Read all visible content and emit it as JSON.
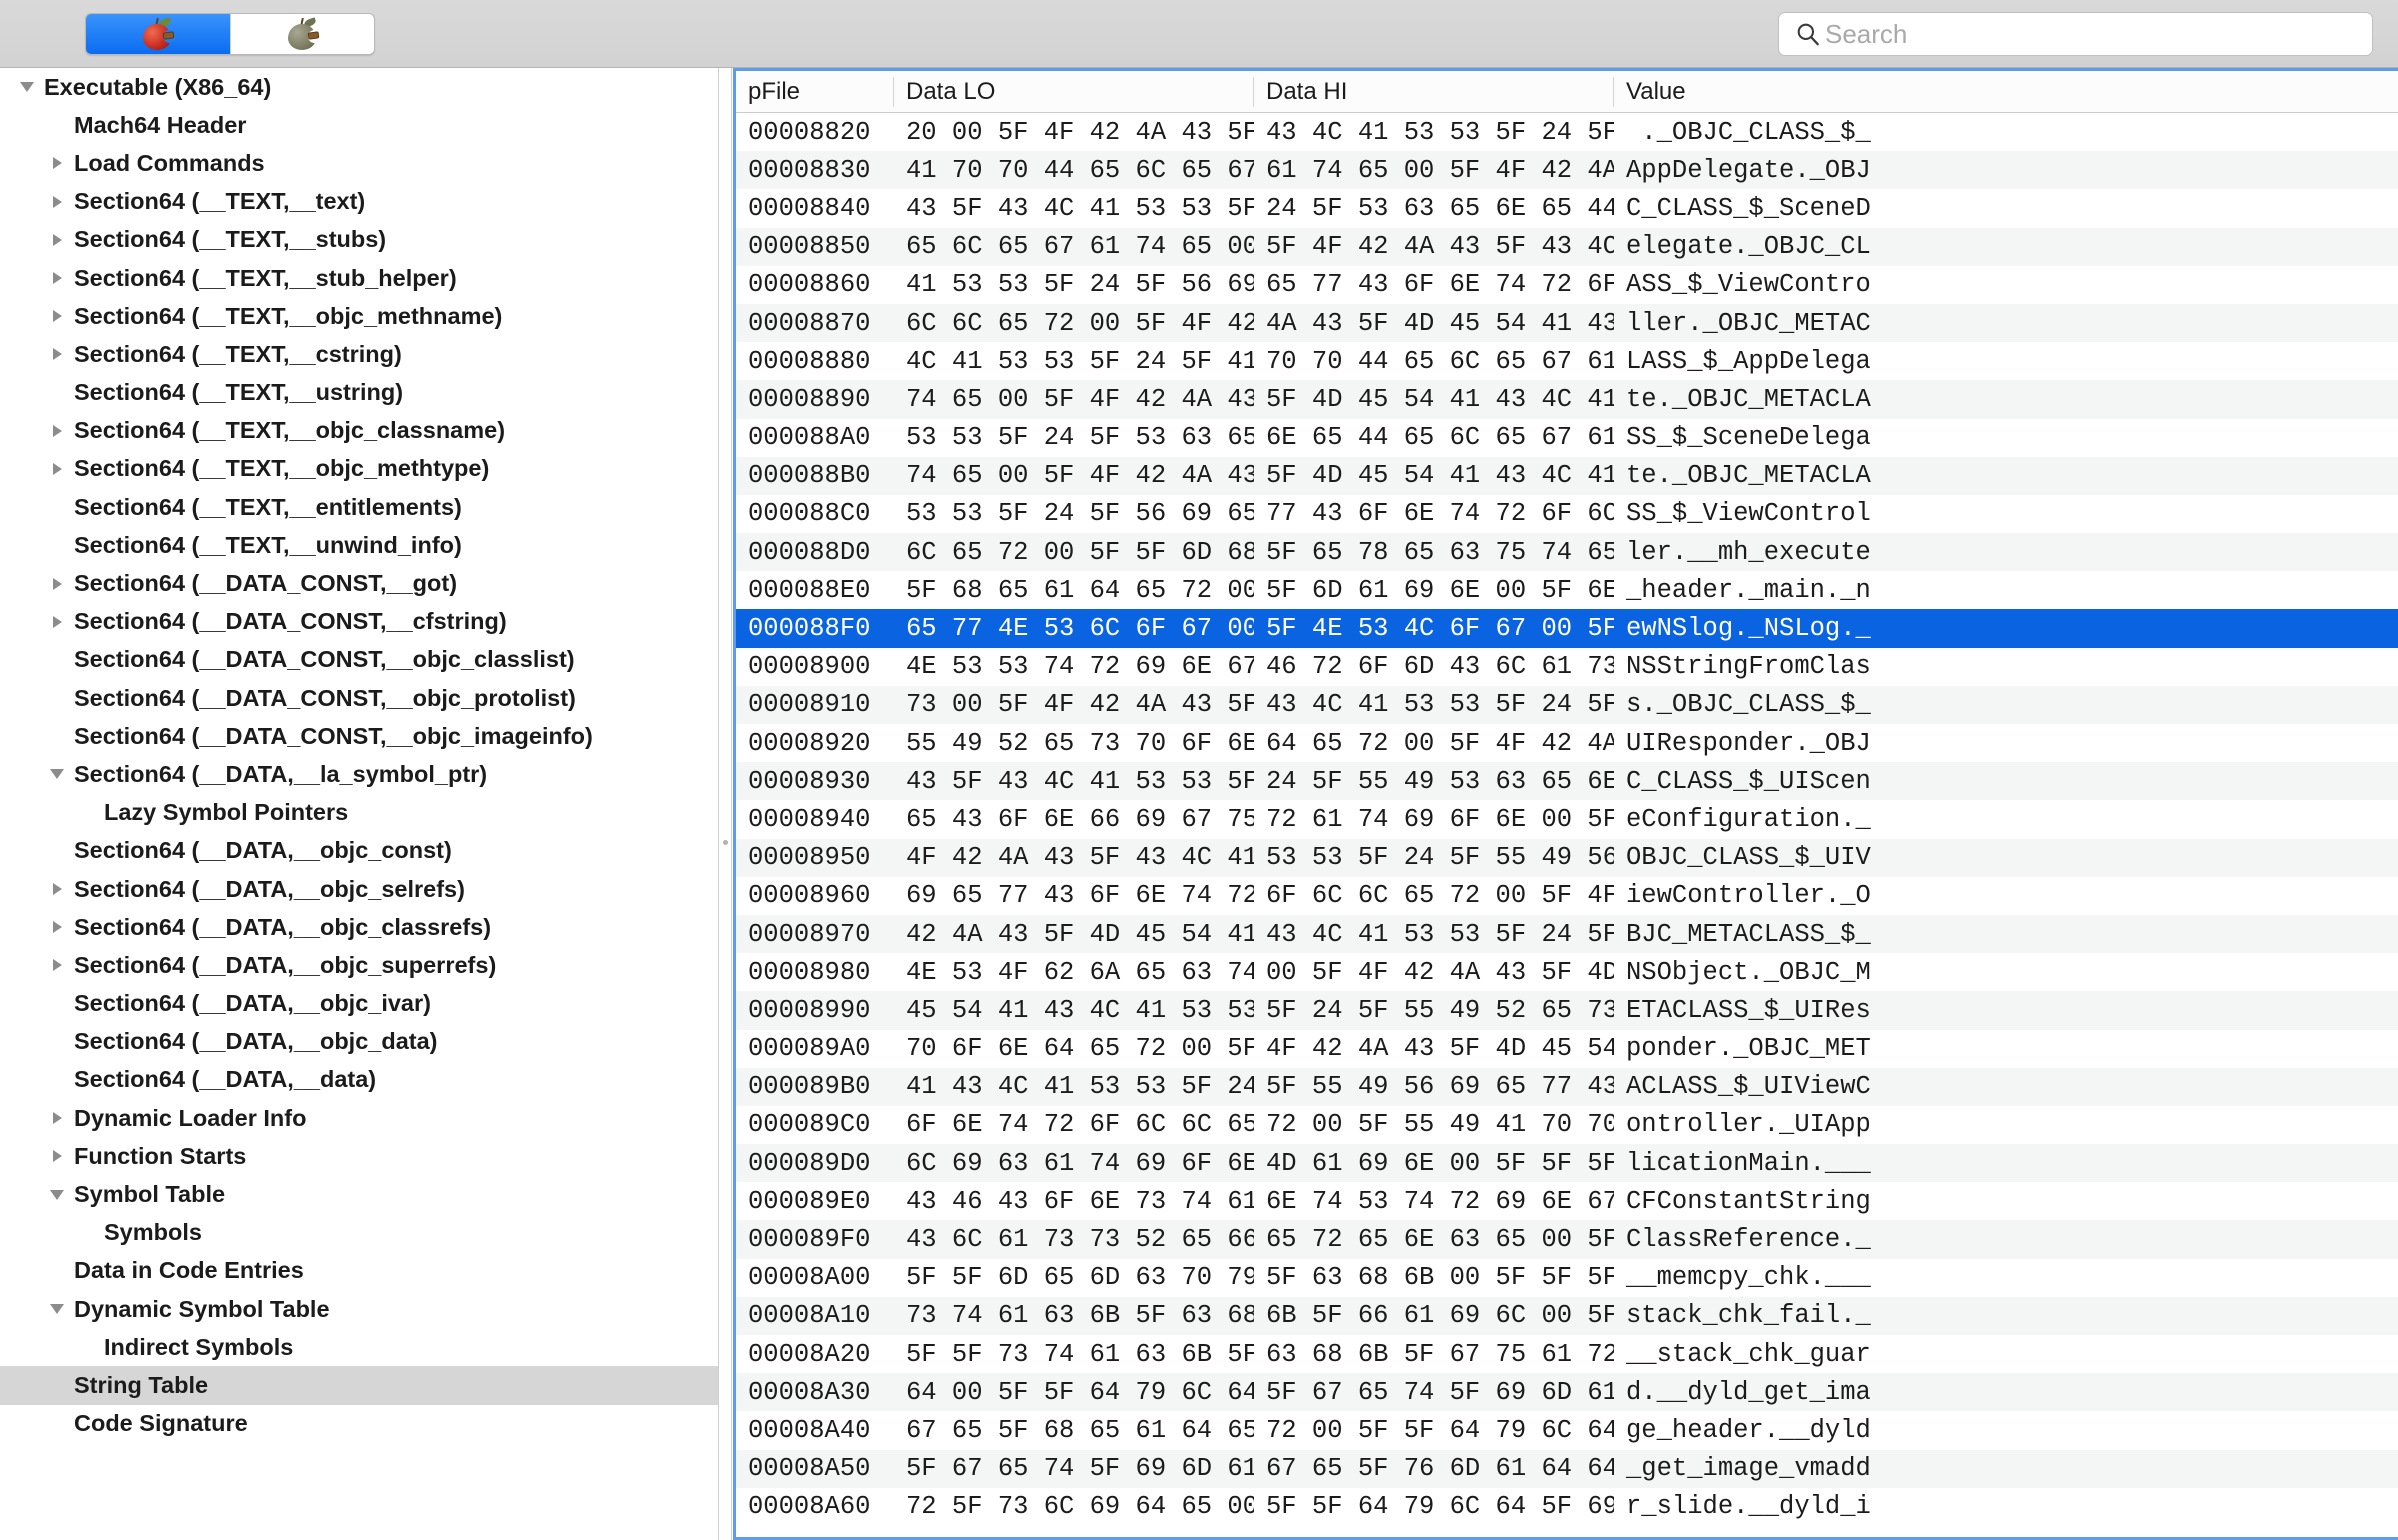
{
  "toolbar": {
    "segments": [
      {
        "name": "machoview-red-apple",
        "icon": "red-apple-icon",
        "selected": true
      },
      {
        "name": "machoview-grey-apple",
        "icon": "grey-apple-icon",
        "selected": false
      }
    ],
    "search": {
      "placeholder": "Search",
      "value": "",
      "icon": "search-icon"
    }
  },
  "colors": {
    "selection_blue": "#0a64e1",
    "pane_focus_border": "#5e9bea",
    "sidebar_selection": "#d6d6d6",
    "toolbar_bg": "#d4d4d4",
    "row_alt": "#f4f6f5"
  },
  "sidebar": {
    "items": [
      {
        "label": "Executable  (X86_64)",
        "indent": 0,
        "twisty": "open",
        "selected": false
      },
      {
        "label": "Mach64 Header",
        "indent": 1,
        "twisty": "none",
        "selected": false
      },
      {
        "label": "Load Commands",
        "indent": 1,
        "twisty": "closed",
        "selected": false
      },
      {
        "label": "Section64 (__TEXT,__text)",
        "indent": 1,
        "twisty": "closed",
        "selected": false
      },
      {
        "label": "Section64 (__TEXT,__stubs)",
        "indent": 1,
        "twisty": "closed",
        "selected": false
      },
      {
        "label": "Section64 (__TEXT,__stub_helper)",
        "indent": 1,
        "twisty": "closed",
        "selected": false
      },
      {
        "label": "Section64 (__TEXT,__objc_methname)",
        "indent": 1,
        "twisty": "closed",
        "selected": false
      },
      {
        "label": "Section64 (__TEXT,__cstring)",
        "indent": 1,
        "twisty": "closed",
        "selected": false
      },
      {
        "label": "Section64 (__TEXT,__ustring)",
        "indent": 1,
        "twisty": "none",
        "selected": false
      },
      {
        "label": "Section64 (__TEXT,__objc_classname)",
        "indent": 1,
        "twisty": "closed",
        "selected": false
      },
      {
        "label": "Section64 (__TEXT,__objc_methtype)",
        "indent": 1,
        "twisty": "closed",
        "selected": false
      },
      {
        "label": "Section64 (__TEXT,__entitlements)",
        "indent": 1,
        "twisty": "none",
        "selected": false
      },
      {
        "label": "Section64 (__TEXT,__unwind_info)",
        "indent": 1,
        "twisty": "none",
        "selected": false
      },
      {
        "label": "Section64 (__DATA_CONST,__got)",
        "indent": 1,
        "twisty": "closed",
        "selected": false
      },
      {
        "label": "Section64 (__DATA_CONST,__cfstring)",
        "indent": 1,
        "twisty": "closed",
        "selected": false
      },
      {
        "label": "Section64 (__DATA_CONST,__objc_classlist)",
        "indent": 1,
        "twisty": "none",
        "selected": false
      },
      {
        "label": "Section64 (__DATA_CONST,__objc_protolist)",
        "indent": 1,
        "twisty": "none",
        "selected": false
      },
      {
        "label": "Section64 (__DATA_CONST,__objc_imageinfo)",
        "indent": 1,
        "twisty": "none",
        "selected": false
      },
      {
        "label": "Section64 (__DATA,__la_symbol_ptr)",
        "indent": 1,
        "twisty": "open",
        "selected": false
      },
      {
        "label": "Lazy Symbol Pointers",
        "indent": 2,
        "twisty": "none",
        "selected": false
      },
      {
        "label": "Section64 (__DATA,__objc_const)",
        "indent": 1,
        "twisty": "none",
        "selected": false
      },
      {
        "label": "Section64 (__DATA,__objc_selrefs)",
        "indent": 1,
        "twisty": "closed",
        "selected": false
      },
      {
        "label": "Section64 (__DATA,__objc_classrefs)",
        "indent": 1,
        "twisty": "closed",
        "selected": false
      },
      {
        "label": "Section64 (__DATA,__objc_superrefs)",
        "indent": 1,
        "twisty": "closed",
        "selected": false
      },
      {
        "label": "Section64 (__DATA,__objc_ivar)",
        "indent": 1,
        "twisty": "none",
        "selected": false
      },
      {
        "label": "Section64 (__DATA,__objc_data)",
        "indent": 1,
        "twisty": "none",
        "selected": false
      },
      {
        "label": "Section64 (__DATA,__data)",
        "indent": 1,
        "twisty": "none",
        "selected": false
      },
      {
        "label": "Dynamic Loader Info",
        "indent": 1,
        "twisty": "closed",
        "selected": false
      },
      {
        "label": "Function Starts",
        "indent": 1,
        "twisty": "closed",
        "selected": false
      },
      {
        "label": "Symbol Table",
        "indent": 1,
        "twisty": "open",
        "selected": false
      },
      {
        "label": "Symbols",
        "indent": 2,
        "twisty": "none",
        "selected": false
      },
      {
        "label": "Data in Code Entries",
        "indent": 1,
        "twisty": "none",
        "selected": false
      },
      {
        "label": "Dynamic Symbol Table",
        "indent": 1,
        "twisty": "open",
        "selected": false
      },
      {
        "label": "Indirect Symbols",
        "indent": 2,
        "twisty": "none",
        "selected": false
      },
      {
        "label": "String Table",
        "indent": 1,
        "twisty": "none",
        "selected": true
      },
      {
        "label": "Code Signature",
        "indent": 1,
        "twisty": "none",
        "selected": false
      }
    ]
  },
  "table": {
    "columns": [
      "pFile",
      "Data LO",
      "Data HI",
      "Value"
    ],
    "rows": [
      {
        "pfile": "00008820",
        "lo": "20 00 5F 4F 42 4A 43 5F",
        "hi": "43 4C 41 53 53 5F 24 5F",
        "value": " ._OBJC_CLASS_$_",
        "selected": false
      },
      {
        "pfile": "00008830",
        "lo": "41 70 70 44 65 6C 65 67",
        "hi": "61 74 65 00 5F 4F 42 4A",
        "value": "AppDelegate._OBJ",
        "selected": false
      },
      {
        "pfile": "00008840",
        "lo": "43 5F 43 4C 41 53 53 5F",
        "hi": "24 5F 53 63 65 6E 65 44",
        "value": "C_CLASS_$_SceneD",
        "selected": false
      },
      {
        "pfile": "00008850",
        "lo": "65 6C 65 67 61 74 65 00",
        "hi": "5F 4F 42 4A 43 5F 43 4C",
        "value": "elegate._OBJC_CL",
        "selected": false
      },
      {
        "pfile": "00008860",
        "lo": "41 53 53 5F 24 5F 56 69",
        "hi": "65 77 43 6F 6E 74 72 6F",
        "value": "ASS_$_ViewContro",
        "selected": false
      },
      {
        "pfile": "00008870",
        "lo": "6C 6C 65 72 00 5F 4F 42",
        "hi": "4A 43 5F 4D 45 54 41 43",
        "value": "ller._OBJC_METAC",
        "selected": false
      },
      {
        "pfile": "00008880",
        "lo": "4C 41 53 53 5F 24 5F 41",
        "hi": "70 70 44 65 6C 65 67 61",
        "value": "LASS_$_AppDelega",
        "selected": false
      },
      {
        "pfile": "00008890",
        "lo": "74 65 00 5F 4F 42 4A 43",
        "hi": "5F 4D 45 54 41 43 4C 41",
        "value": "te._OBJC_METACLA",
        "selected": false
      },
      {
        "pfile": "000088A0",
        "lo": "53 53 5F 24 5F 53 63 65",
        "hi": "6E 65 44 65 6C 65 67 61",
        "value": "SS_$_SceneDelega",
        "selected": false
      },
      {
        "pfile": "000088B0",
        "lo": "74 65 00 5F 4F 42 4A 43",
        "hi": "5F 4D 45 54 41 43 4C 41",
        "value": "te._OBJC_METACLA",
        "selected": false
      },
      {
        "pfile": "000088C0",
        "lo": "53 53 5F 24 5F 56 69 65",
        "hi": "77 43 6F 6E 74 72 6F 6C",
        "value": "SS_$_ViewControl",
        "selected": false
      },
      {
        "pfile": "000088D0",
        "lo": "6C 65 72 00 5F 5F 6D 68",
        "hi": "5F 65 78 65 63 75 74 65",
        "value": "ler.__mh_execute",
        "selected": false
      },
      {
        "pfile": "000088E0",
        "lo": "5F 68 65 61 64 65 72 00",
        "hi": "5F 6D 61 69 6E 00 5F 6E",
        "value": "_header._main._n",
        "selected": false
      },
      {
        "pfile": "000088F0",
        "lo": "65 77 4E 53 6C 6F 67 00",
        "hi": "5F 4E 53 4C 6F 67 00 5F",
        "value": "ewNSlog._NSLog._",
        "selected": true
      },
      {
        "pfile": "00008900",
        "lo": "4E 53 53 74 72 69 6E 67",
        "hi": "46 72 6F 6D 43 6C 61 73",
        "value": "NSStringFromClas",
        "selected": false
      },
      {
        "pfile": "00008910",
        "lo": "73 00 5F 4F 42 4A 43 5F",
        "hi": "43 4C 41 53 53 5F 24 5F",
        "value": "s._OBJC_CLASS_$_",
        "selected": false
      },
      {
        "pfile": "00008920",
        "lo": "55 49 52 65 73 70 6F 6E",
        "hi": "64 65 72 00 5F 4F 42 4A",
        "value": "UIResponder._OBJ",
        "selected": false
      },
      {
        "pfile": "00008930",
        "lo": "43 5F 43 4C 41 53 53 5F",
        "hi": "24 5F 55 49 53 63 65 6E",
        "value": "C_CLASS_$_UIScen",
        "selected": false
      },
      {
        "pfile": "00008940",
        "lo": "65 43 6F 6E 66 69 67 75",
        "hi": "72 61 74 69 6F 6E 00 5F",
        "value": "eConfiguration._",
        "selected": false
      },
      {
        "pfile": "00008950",
        "lo": "4F 42 4A 43 5F 43 4C 41",
        "hi": "53 53 5F 24 5F 55 49 56",
        "value": "OBJC_CLASS_$_UIV",
        "selected": false
      },
      {
        "pfile": "00008960",
        "lo": "69 65 77 43 6F 6E 74 72",
        "hi": "6F 6C 6C 65 72 00 5F 4F",
        "value": "iewController._O",
        "selected": false
      },
      {
        "pfile": "00008970",
        "lo": "42 4A 43 5F 4D 45 54 41",
        "hi": "43 4C 41 53 53 5F 24 5F",
        "value": "BJC_METACLASS_$_",
        "selected": false
      },
      {
        "pfile": "00008980",
        "lo": "4E 53 4F 62 6A 65 63 74",
        "hi": "00 5F 4F 42 4A 43 5F 4D",
        "value": "NSObject._OBJC_M",
        "selected": false
      },
      {
        "pfile": "00008990",
        "lo": "45 54 41 43 4C 41 53 53",
        "hi": "5F 24 5F 55 49 52 65 73",
        "value": "ETACLASS_$_UIRes",
        "selected": false
      },
      {
        "pfile": "000089A0",
        "lo": "70 6F 6E 64 65 72 00 5F",
        "hi": "4F 42 4A 43 5F 4D 45 54",
        "value": "ponder._OBJC_MET",
        "selected": false
      },
      {
        "pfile": "000089B0",
        "lo": "41 43 4C 41 53 53 5F 24",
        "hi": "5F 55 49 56 69 65 77 43",
        "value": "ACLASS_$_UIViewC",
        "selected": false
      },
      {
        "pfile": "000089C0",
        "lo": "6F 6E 74 72 6F 6C 6C 65",
        "hi": "72 00 5F 55 49 41 70 70",
        "value": "ontroller._UIApp",
        "selected": false
      },
      {
        "pfile": "000089D0",
        "lo": "6C 69 63 61 74 69 6F 6E",
        "hi": "4D 61 69 6E 00 5F 5F 5F",
        "value": "licationMain.___",
        "selected": false
      },
      {
        "pfile": "000089E0",
        "lo": "43 46 43 6F 6E 73 74 61",
        "hi": "6E 74 53 74 72 69 6E 67",
        "value": "CFConstantString",
        "selected": false
      },
      {
        "pfile": "000089F0",
        "lo": "43 6C 61 73 73 52 65 66",
        "hi": "65 72 65 6E 63 65 00 5F",
        "value": "ClassReference._",
        "selected": false
      },
      {
        "pfile": "00008A00",
        "lo": "5F 5F 6D 65 6D 63 70 79",
        "hi": "5F 63 68 6B 00 5F 5F 5F",
        "value": "__memcpy_chk.___",
        "selected": false
      },
      {
        "pfile": "00008A10",
        "lo": "73 74 61 63 6B 5F 63 68",
        "hi": "6B 5F 66 61 69 6C 00 5F",
        "value": "stack_chk_fail._",
        "selected": false
      },
      {
        "pfile": "00008A20",
        "lo": "5F 5F 73 74 61 63 6B 5F",
        "hi": "63 68 6B 5F 67 75 61 72",
        "value": "__stack_chk_guar",
        "selected": false
      },
      {
        "pfile": "00008A30",
        "lo": "64 00 5F 5F 64 79 6C 64",
        "hi": "5F 67 65 74 5F 69 6D 61",
        "value": "d.__dyld_get_ima",
        "selected": false
      },
      {
        "pfile": "00008A40",
        "lo": "67 65 5F 68 65 61 64 65",
        "hi": "72 00 5F 5F 64 79 6C 64",
        "value": "ge_header.__dyld",
        "selected": false
      },
      {
        "pfile": "00008A50",
        "lo": "5F 67 65 74 5F 69 6D 61",
        "hi": "67 65 5F 76 6D 61 64 64",
        "value": "_get_image_vmadd",
        "selected": false
      },
      {
        "pfile": "00008A60",
        "lo": "72 5F 73 6C 69 64 65 00",
        "hi": "5F 5F 64 79 6C 64 5F 69",
        "value": "r_slide.__dyld_i",
        "selected": false
      }
    ]
  }
}
